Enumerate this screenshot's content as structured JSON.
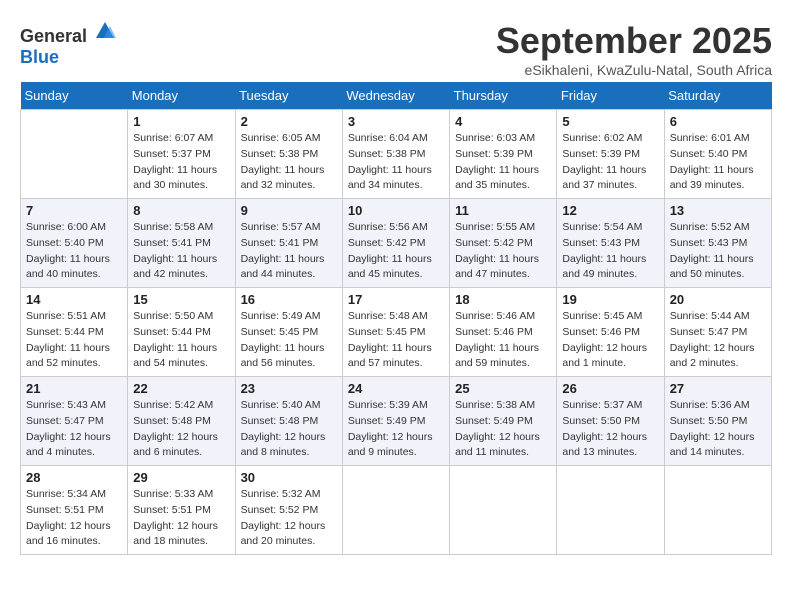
{
  "header": {
    "logo_general": "General",
    "logo_blue": "Blue",
    "month": "September 2025",
    "location": "eSikhaleni, KwaZulu-Natal, South Africa"
  },
  "days_of_week": [
    "Sunday",
    "Monday",
    "Tuesday",
    "Wednesday",
    "Thursday",
    "Friday",
    "Saturday"
  ],
  "weeks": [
    [
      {
        "day": "",
        "sunrise": "",
        "sunset": "",
        "daylight": ""
      },
      {
        "day": "1",
        "sunrise": "Sunrise: 6:07 AM",
        "sunset": "Sunset: 5:37 PM",
        "daylight": "Daylight: 11 hours and 30 minutes."
      },
      {
        "day": "2",
        "sunrise": "Sunrise: 6:05 AM",
        "sunset": "Sunset: 5:38 PM",
        "daylight": "Daylight: 11 hours and 32 minutes."
      },
      {
        "day": "3",
        "sunrise": "Sunrise: 6:04 AM",
        "sunset": "Sunset: 5:38 PM",
        "daylight": "Daylight: 11 hours and 34 minutes."
      },
      {
        "day": "4",
        "sunrise": "Sunrise: 6:03 AM",
        "sunset": "Sunset: 5:39 PM",
        "daylight": "Daylight: 11 hours and 35 minutes."
      },
      {
        "day": "5",
        "sunrise": "Sunrise: 6:02 AM",
        "sunset": "Sunset: 5:39 PM",
        "daylight": "Daylight: 11 hours and 37 minutes."
      },
      {
        "day": "6",
        "sunrise": "Sunrise: 6:01 AM",
        "sunset": "Sunset: 5:40 PM",
        "daylight": "Daylight: 11 hours and 39 minutes."
      }
    ],
    [
      {
        "day": "7",
        "sunrise": "Sunrise: 6:00 AM",
        "sunset": "Sunset: 5:40 PM",
        "daylight": "Daylight: 11 hours and 40 minutes."
      },
      {
        "day": "8",
        "sunrise": "Sunrise: 5:58 AM",
        "sunset": "Sunset: 5:41 PM",
        "daylight": "Daylight: 11 hours and 42 minutes."
      },
      {
        "day": "9",
        "sunrise": "Sunrise: 5:57 AM",
        "sunset": "Sunset: 5:41 PM",
        "daylight": "Daylight: 11 hours and 44 minutes."
      },
      {
        "day": "10",
        "sunrise": "Sunrise: 5:56 AM",
        "sunset": "Sunset: 5:42 PM",
        "daylight": "Daylight: 11 hours and 45 minutes."
      },
      {
        "day": "11",
        "sunrise": "Sunrise: 5:55 AM",
        "sunset": "Sunset: 5:42 PM",
        "daylight": "Daylight: 11 hours and 47 minutes."
      },
      {
        "day": "12",
        "sunrise": "Sunrise: 5:54 AM",
        "sunset": "Sunset: 5:43 PM",
        "daylight": "Daylight: 11 hours and 49 minutes."
      },
      {
        "day": "13",
        "sunrise": "Sunrise: 5:52 AM",
        "sunset": "Sunset: 5:43 PM",
        "daylight": "Daylight: 11 hours and 50 minutes."
      }
    ],
    [
      {
        "day": "14",
        "sunrise": "Sunrise: 5:51 AM",
        "sunset": "Sunset: 5:44 PM",
        "daylight": "Daylight: 11 hours and 52 minutes."
      },
      {
        "day": "15",
        "sunrise": "Sunrise: 5:50 AM",
        "sunset": "Sunset: 5:44 PM",
        "daylight": "Daylight: 11 hours and 54 minutes."
      },
      {
        "day": "16",
        "sunrise": "Sunrise: 5:49 AM",
        "sunset": "Sunset: 5:45 PM",
        "daylight": "Daylight: 11 hours and 56 minutes."
      },
      {
        "day": "17",
        "sunrise": "Sunrise: 5:48 AM",
        "sunset": "Sunset: 5:45 PM",
        "daylight": "Daylight: 11 hours and 57 minutes."
      },
      {
        "day": "18",
        "sunrise": "Sunrise: 5:46 AM",
        "sunset": "Sunset: 5:46 PM",
        "daylight": "Daylight: 11 hours and 59 minutes."
      },
      {
        "day": "19",
        "sunrise": "Sunrise: 5:45 AM",
        "sunset": "Sunset: 5:46 PM",
        "daylight": "Daylight: 12 hours and 1 minute."
      },
      {
        "day": "20",
        "sunrise": "Sunrise: 5:44 AM",
        "sunset": "Sunset: 5:47 PM",
        "daylight": "Daylight: 12 hours and 2 minutes."
      }
    ],
    [
      {
        "day": "21",
        "sunrise": "Sunrise: 5:43 AM",
        "sunset": "Sunset: 5:47 PM",
        "daylight": "Daylight: 12 hours and 4 minutes."
      },
      {
        "day": "22",
        "sunrise": "Sunrise: 5:42 AM",
        "sunset": "Sunset: 5:48 PM",
        "daylight": "Daylight: 12 hours and 6 minutes."
      },
      {
        "day": "23",
        "sunrise": "Sunrise: 5:40 AM",
        "sunset": "Sunset: 5:48 PM",
        "daylight": "Daylight: 12 hours and 8 minutes."
      },
      {
        "day": "24",
        "sunrise": "Sunrise: 5:39 AM",
        "sunset": "Sunset: 5:49 PM",
        "daylight": "Daylight: 12 hours and 9 minutes."
      },
      {
        "day": "25",
        "sunrise": "Sunrise: 5:38 AM",
        "sunset": "Sunset: 5:49 PM",
        "daylight": "Daylight: 12 hours and 11 minutes."
      },
      {
        "day": "26",
        "sunrise": "Sunrise: 5:37 AM",
        "sunset": "Sunset: 5:50 PM",
        "daylight": "Daylight: 12 hours and 13 minutes."
      },
      {
        "day": "27",
        "sunrise": "Sunrise: 5:36 AM",
        "sunset": "Sunset: 5:50 PM",
        "daylight": "Daylight: 12 hours and 14 minutes."
      }
    ],
    [
      {
        "day": "28",
        "sunrise": "Sunrise: 5:34 AM",
        "sunset": "Sunset: 5:51 PM",
        "daylight": "Daylight: 12 hours and 16 minutes."
      },
      {
        "day": "29",
        "sunrise": "Sunrise: 5:33 AM",
        "sunset": "Sunset: 5:51 PM",
        "daylight": "Daylight: 12 hours and 18 minutes."
      },
      {
        "day": "30",
        "sunrise": "Sunrise: 5:32 AM",
        "sunset": "Sunset: 5:52 PM",
        "daylight": "Daylight: 12 hours and 20 minutes."
      },
      {
        "day": "",
        "sunrise": "",
        "sunset": "",
        "daylight": ""
      },
      {
        "day": "",
        "sunrise": "",
        "sunset": "",
        "daylight": ""
      },
      {
        "day": "",
        "sunrise": "",
        "sunset": "",
        "daylight": ""
      },
      {
        "day": "",
        "sunrise": "",
        "sunset": "",
        "daylight": ""
      }
    ]
  ]
}
